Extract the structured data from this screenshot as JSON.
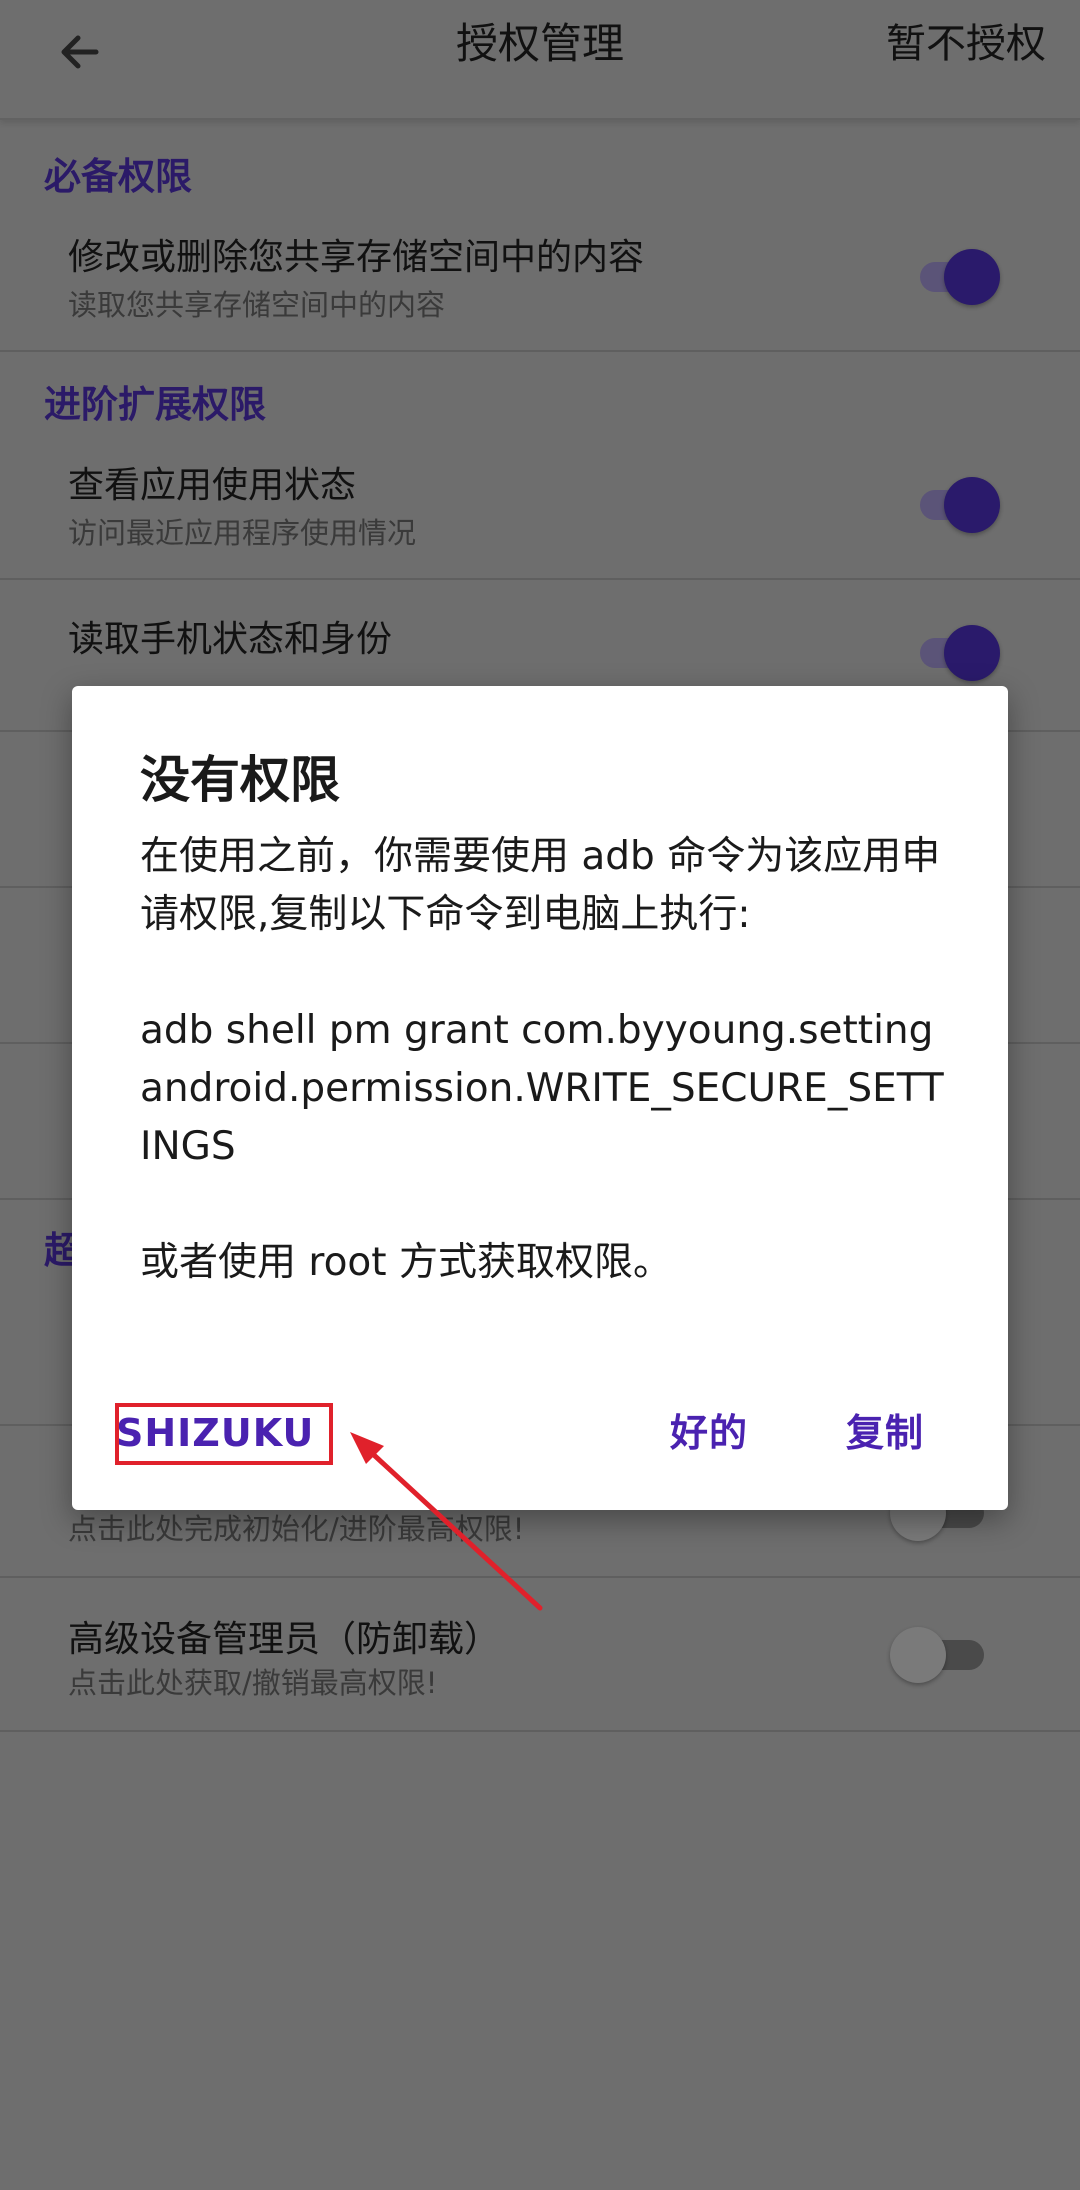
{
  "app_bar": {
    "title": "授权管理",
    "action": "暂不授权"
  },
  "sections": {
    "required": {
      "header": "必备权限",
      "items": [
        {
          "title": "修改或删除您共享存储空间中的内容",
          "subtitle": "读取您共享存储空间中的内容",
          "enabled": true
        }
      ]
    },
    "advanced": {
      "header": "进阶扩展权限",
      "items": [
        {
          "title": "查看应用使用状态",
          "subtitle": "访问最近应用程序使用情况",
          "enabled": true
        },
        {
          "title": "读取手机状态和身份",
          "enabled": true
        }
      ]
    },
    "super": {
      "header": "超",
      "items": [
        {
          "subtitle": "点击此处完成初始化/进阶最高权限!",
          "enabled": false
        },
        {
          "title": "高级设备管理员（防卸载）",
          "subtitle": "点击此处获取/撤销最高权限!",
          "enabled": false
        }
      ]
    }
  },
  "dialog": {
    "title": "没有权限",
    "message_1": "在使用之前，你需要使用 adb 命令为该应用申请权限,复制以下命令到电脑上执行:",
    "command": "adb shell pm grant com.byyoung.setting android.permission.WRITE_SECURE_SETTINGS",
    "message_2": "或者使用 root 方式获取权限。",
    "buttons": {
      "shizuku": "SHIZUKU",
      "ok": "好的",
      "copy": "复制"
    }
  },
  "colors": {
    "accent": "#4a22b0",
    "highlight": "#e0212b",
    "toggle_on": "#2a1a6b"
  }
}
